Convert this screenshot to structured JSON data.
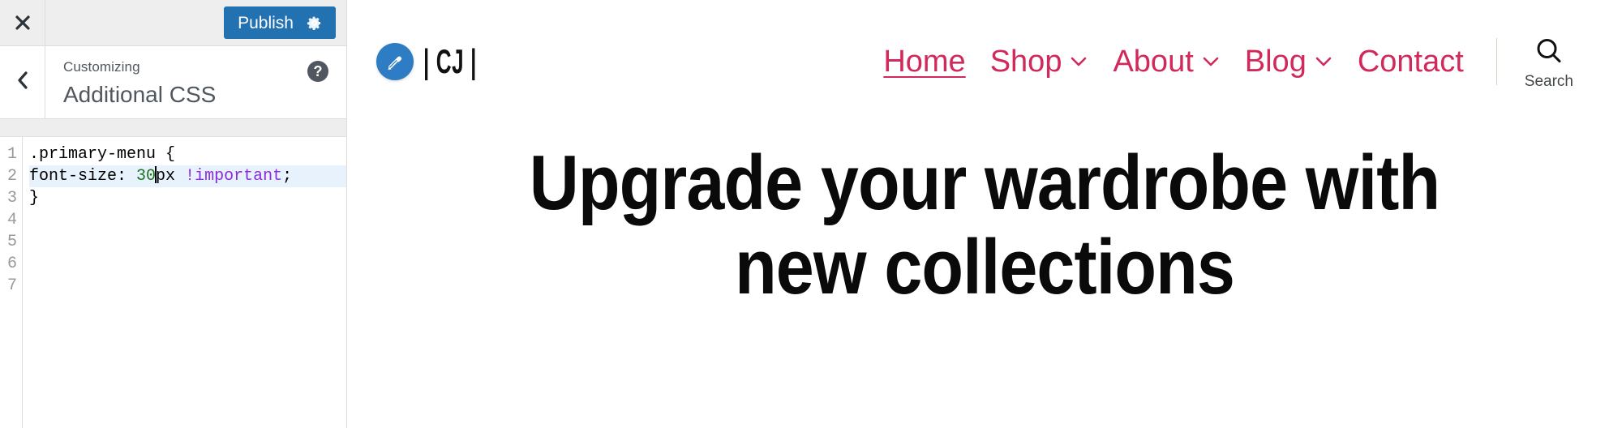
{
  "customizer": {
    "topbar": {
      "close_icon": "close-x-icon",
      "publish_label": "Publish",
      "gear_icon": "gear-icon"
    },
    "back_icon": "chevron-left-icon",
    "eyebrow": "Customizing",
    "title": "Additional CSS",
    "help_icon": "?",
    "editor": {
      "line_numbers": [
        "1",
        "2",
        "3",
        "4",
        "5",
        "6",
        "7"
      ],
      "active_line": 2,
      "code_lines": [
        ".primary-menu {",
        "font-size: 30px !important;",
        "}",
        "",
        "",
        "",
        ""
      ],
      "tokens": {
        "l1_selector": ".primary-menu {",
        "l2_prop": "font-size: ",
        "l2_num": "30",
        "l2_unit": "px ",
        "l2_important": "!important",
        "l2_semi": ";",
        "l3_brace": "}"
      }
    }
  },
  "preview": {
    "brand": {
      "badge_icon": "pencil-edit-icon",
      "text": "| CJ |"
    },
    "nav": {
      "items": [
        {
          "label": "Home",
          "has_dropdown": false,
          "current": true
        },
        {
          "label": "Shop",
          "has_dropdown": true,
          "current": false
        },
        {
          "label": "About",
          "has_dropdown": true,
          "current": false
        },
        {
          "label": "Blog",
          "has_dropdown": true,
          "current": false
        },
        {
          "label": "Contact",
          "has_dropdown": false,
          "current": false
        }
      ],
      "accent_color": "#d0295a"
    },
    "search": {
      "icon": "search-magnifier-icon",
      "label": "Search"
    },
    "hero": {
      "title": "Upgrade your wardrobe with new collections"
    }
  },
  "colors": {
    "publish_blue": "#2271b1",
    "brand_blue": "#2e7cc4",
    "nav_crimson": "#d0295a",
    "panel_grey": "#eeeeee",
    "text_grey": "#50575e",
    "css_number_green": "#1d7324",
    "css_important_purple": "#8a2be2"
  }
}
